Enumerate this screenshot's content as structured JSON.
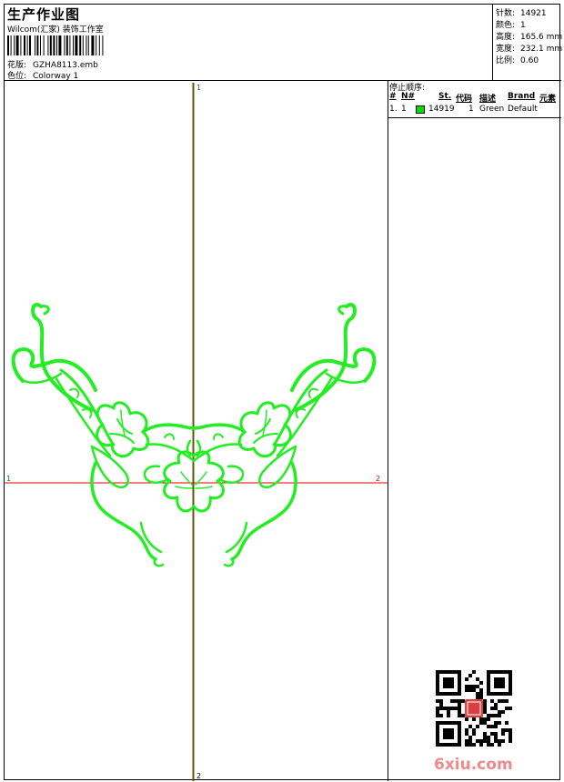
{
  "header": {
    "title": "生产作业图",
    "company": "Wilcom(汇家) 装饰工作室",
    "design_label": "花版:",
    "design_value": "GZHA8113.emb",
    "colorway_label": "色位:",
    "colorway_value": "Colorway 1"
  },
  "stats": [
    {
      "label": "针数:",
      "value": "14921"
    },
    {
      "label": "颜色:",
      "value": "1"
    },
    {
      "label": "高度:",
      "value": "165.6 mm"
    },
    {
      "label": "宽度:",
      "value": "232.1 mm"
    },
    {
      "label": "比例:",
      "value": "0.60"
    }
  ],
  "canvas": {
    "vertical_axis_top": "1",
    "vertical_axis_bottom": "2",
    "horizontal_axis_left": "1",
    "horizontal_axis_right": "2",
    "vertical_axis_color": "#008000",
    "vertical_axis_color2": "#cc2200",
    "horizontal_axis_color": "#e00000",
    "design_color": "#22ee22"
  },
  "stop_sequence": {
    "title": "停止顺序:",
    "columns": [
      "#",
      "N#",
      "St.",
      "代码",
      "描述",
      "Brand",
      "元素"
    ],
    "rows": [
      {
        "index": "1.",
        "needle": "1",
        "color": "#00dd00",
        "stitches": "14919",
        "code": "1",
        "description": "Green",
        "brand": "Default",
        "element": ""
      }
    ]
  },
  "watermark": {
    "text": "6xiu.com",
    "color": "#f08a8a"
  }
}
